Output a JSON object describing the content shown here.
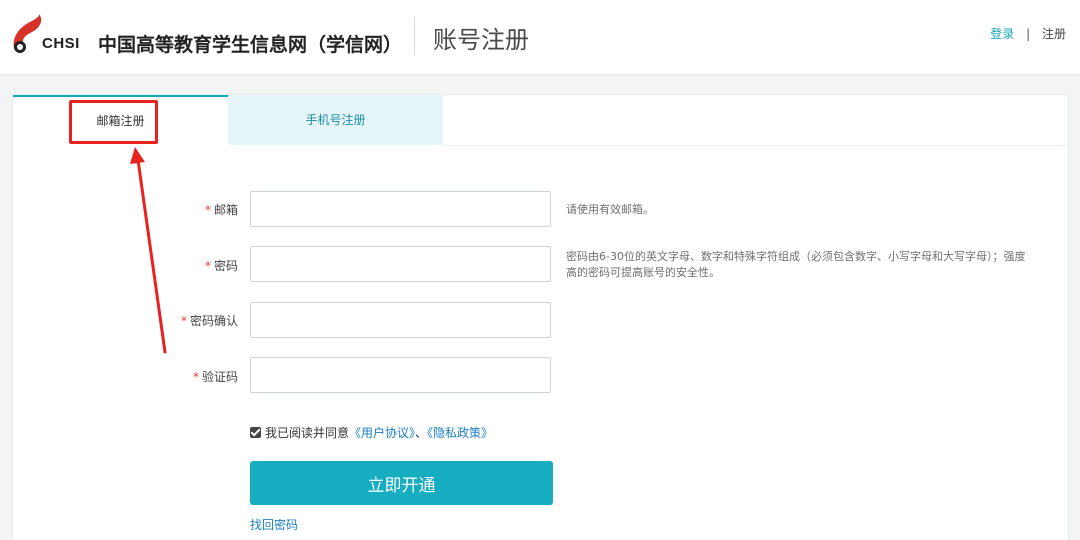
{
  "header": {
    "logo_text": "CHSI",
    "site_name": "中国高等教育学生信息网（学信网）",
    "page_title": "账号注册",
    "login_link": "登录",
    "separator": "|",
    "register_link": "注册"
  },
  "tabs": [
    {
      "label": "邮箱注册",
      "active": true
    },
    {
      "label": "手机号注册",
      "active": false
    }
  ],
  "form": {
    "required_mark": "*",
    "email": {
      "label": "邮箱",
      "value": "",
      "hint": "请使用有效邮箱。"
    },
    "password": {
      "label": "密码",
      "value": "",
      "hint": "密码由6-30位的英文字母、数字和特殊字符组成（必须包含数字、小写字母和大写字母）；强度高的密码可提高账号的安全性。"
    },
    "password_confirm": {
      "label": "密码确认",
      "value": ""
    },
    "captcha": {
      "label": "验证码",
      "value": ""
    },
    "agree": {
      "checked": true,
      "text": "我已阅读并同意",
      "user_agreement": "《用户协议》",
      "separator": "、",
      "privacy_policy": "《隐私政策》"
    },
    "submit_label": "立即开通",
    "forgot_link": "找回密码"
  },
  "colors": {
    "accent": "#16adc0",
    "link": "#1a7fc0",
    "required": "#e23b3b",
    "annotation": "#e6231f"
  }
}
